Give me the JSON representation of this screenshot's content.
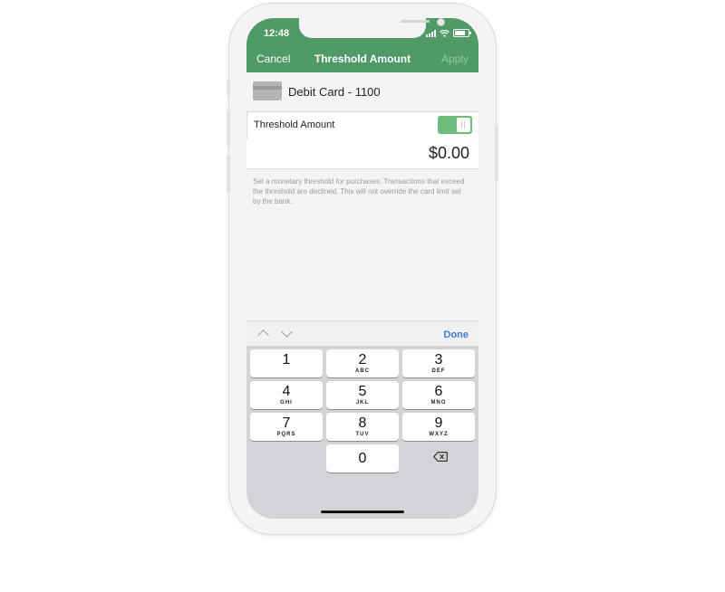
{
  "status": {
    "time": "12:48"
  },
  "nav": {
    "cancel": "Cancel",
    "title": "Threshold Amount",
    "apply": "Apply"
  },
  "card": {
    "label": "Debit Card - 1100"
  },
  "toggle": {
    "label": "Threshold Amount",
    "state": "on"
  },
  "amount": {
    "value": "$0.00"
  },
  "description": "Set a monetary threshold for purchases. Transactions that exceed the threshold are declined. This will not override the card limit set by the bank.",
  "keyboard": {
    "done": "Done",
    "keys": [
      {
        "num": "1",
        "letters": ""
      },
      {
        "num": "2",
        "letters": "ABC"
      },
      {
        "num": "3",
        "letters": "DEF"
      },
      {
        "num": "4",
        "letters": "GHI"
      },
      {
        "num": "5",
        "letters": "JKL"
      },
      {
        "num": "6",
        "letters": "MNO"
      },
      {
        "num": "7",
        "letters": "PQRS"
      },
      {
        "num": "8",
        "letters": "TUV"
      },
      {
        "num": "9",
        "letters": "WXYZ"
      },
      {
        "num": "0",
        "letters": ""
      }
    ]
  },
  "colors": {
    "header": "#4f9a66",
    "toggle_on": "#6dbb7d",
    "done": "#3b7bd8"
  }
}
